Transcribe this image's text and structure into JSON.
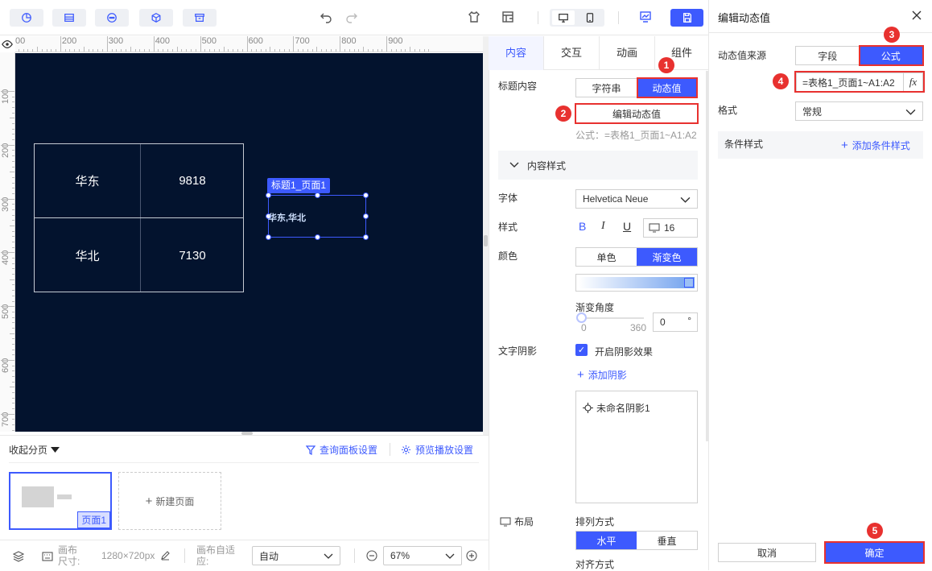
{
  "toolbar": {
    "buttons": [
      "chart-icon",
      "table-icon",
      "widget-icon",
      "component-icon",
      "archive-icon"
    ],
    "undo_icon": "undo-icon",
    "redo_icon": "redo-icon",
    "theme_icon": "theme-icon",
    "template_icon": "template-icon",
    "device_desktop": "desktop-icon",
    "device_mobile": "mobile-icon",
    "preview_icon": "preview-icon",
    "save_icon": "save-icon"
  },
  "ruler": {
    "top_labels": [
      "00",
      "200",
      "300",
      "400",
      "500",
      "600",
      "700",
      "800",
      "900"
    ],
    "left_labels": [
      "100",
      "200",
      "300",
      "400",
      "500",
      "600",
      "700"
    ]
  },
  "canvas": {
    "table": [
      [
        "华东",
        "9818"
      ],
      [
        "华北",
        "7130"
      ]
    ],
    "selected_label": "标题1_页面1",
    "selected_text": "华东,华北"
  },
  "pages": {
    "collapse_label": "收起分页",
    "query_settings": "查询面板设置",
    "preview_settings": "预览播放设置",
    "page_tag": "页面1",
    "new_page": "新建页面"
  },
  "status": {
    "canvas_size_label": "画布尺寸:",
    "canvas_size_value": "1280×720px",
    "adapt_label": "画布自适应:",
    "adapt_value": "自动",
    "zoom_value": "67%"
  },
  "props": {
    "tabs": [
      "内容",
      "交互",
      "动画",
      "组件"
    ],
    "active_tab": "内容",
    "title_content_label": "标题内容",
    "seg_string": "字符串",
    "seg_dynamic": "动态值",
    "edit_dynamic": "编辑动态值",
    "formula_hint": "公式：=表格1_页面1~A1:A2",
    "content_style": "内容样式",
    "font_label": "字体",
    "font_value": "Helvetica Neue",
    "style_label": "样式",
    "bold": "B",
    "italic": "I",
    "underline": "U",
    "font_size": "16",
    "color_label": "颜色",
    "color_single": "单色",
    "color_gradient": "渐变色",
    "gradient_angle_label": "渐变角度",
    "angle_min": "0",
    "angle_max": "360",
    "angle_value": "0",
    "angle_unit": "°",
    "shadow_label": "文字阴影",
    "enable_shadow": "开启阴影效果",
    "add_shadow": "添加阴影",
    "shadow_item": "未命名阴影1",
    "layout_label": "布局",
    "arrange_label": "排列方式",
    "horizontal": "水平",
    "vertical": "垂直",
    "align_label": "对齐方式"
  },
  "dialog": {
    "title": "编辑动态值",
    "source_label": "动态值来源",
    "seg_field": "字段",
    "seg_formula": "公式",
    "formula_value": "=表格1_页面1~A1:A2",
    "fx": "fx",
    "format_label": "格式",
    "format_value": "常规",
    "cond_style_label": "条件样式",
    "add_cond_style": "添加条件样式",
    "cancel": "取消",
    "confirm": "确定"
  },
  "badges": [
    "1",
    "2",
    "3",
    "4",
    "5"
  ],
  "colors": {
    "accent": "#3d5afe",
    "canvas_bg": "#03132e",
    "highlight_red": "#e8312f"
  }
}
